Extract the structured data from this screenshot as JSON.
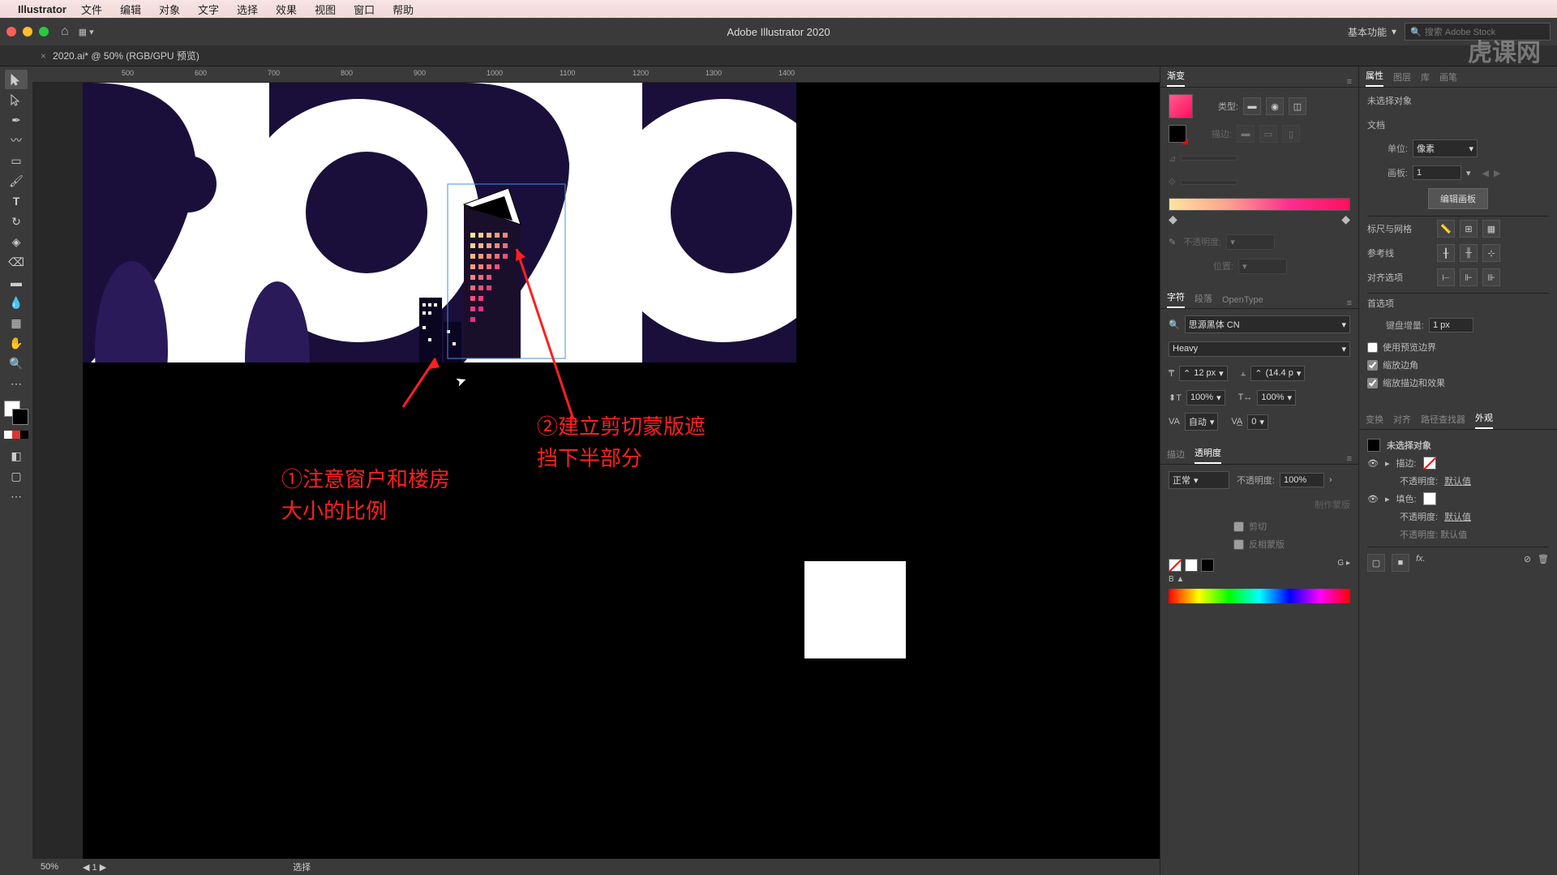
{
  "mac_menu": {
    "app": "Illustrator",
    "items": [
      "文件",
      "编辑",
      "对象",
      "文字",
      "选择",
      "效果",
      "视图",
      "窗口",
      "帮助"
    ]
  },
  "app_bar": {
    "title": "Adobe Illustrator 2020",
    "workspace": "基本功能",
    "search_placeholder": "搜索 Adobe Stock"
  },
  "doc_tab": "2020.ai* @ 50% (RGB/GPU 预览)",
  "ruler_marks": [
    "500",
    "600",
    "700",
    "800",
    "900",
    "1000",
    "1100",
    "1200",
    "1300",
    "1400"
  ],
  "annotations": {
    "a1": "①注意窗户和楼房大小的比例",
    "a2": "②建立剪切蒙版遮挡下半部分"
  },
  "status": {
    "zoom": "50%",
    "artboard": "1",
    "tool": "选择"
  },
  "gradient_panel": {
    "tab": "渐变",
    "type_label": "类型:",
    "stroke_label": "描边:",
    "opacity_label": "不透明度:",
    "position_label": "位置:"
  },
  "char_panel": {
    "tabs": [
      "字符",
      "段落",
      "OpenType"
    ],
    "font": "思源黑体 CN",
    "weight": "Heavy",
    "size": "12 px",
    "leading": "(14.4 p",
    "h_scale": "100%",
    "v_scale": "100%",
    "tracking": "自动",
    "kerning": "0"
  },
  "trans_panel": {
    "tabs": [
      "描边",
      "透明度"
    ],
    "blend": "正常",
    "opacity_label": "不透明度:",
    "opacity": "100%",
    "make_mask": "制作蒙版",
    "clip": "剪切",
    "invert": "反相蒙版"
  },
  "props_panel": {
    "tabs": [
      "属性",
      "图层",
      "库",
      "画笔"
    ],
    "no_selection": "未选择对象",
    "doc_label": "文档",
    "unit_label": "单位:",
    "unit": "像素",
    "artboard_label": "画板:",
    "artboard": "1",
    "edit_artboard": "编辑画板",
    "ruler_grid": "标尺与网格",
    "guides": "参考线",
    "snap": "对齐选项",
    "prefs": "首选项",
    "key_inc_label": "键盘增量:",
    "key_inc": "1 px",
    "preview_bounds": "使用预览边界",
    "scale_corners": "缩放边角",
    "scale_strokes": "缩放描边和效果"
  },
  "appearance_panel": {
    "tabs": [
      "变换",
      "对齐",
      "路径查找器",
      "外观"
    ],
    "no_selection": "未选择对象",
    "stroke": "描边:",
    "fill": "填色:",
    "opacity_label": "不透明度:",
    "opacity_default": "默认值",
    "opacity_trunc": "不透明度: 默认值"
  },
  "watermark": "虎课网"
}
